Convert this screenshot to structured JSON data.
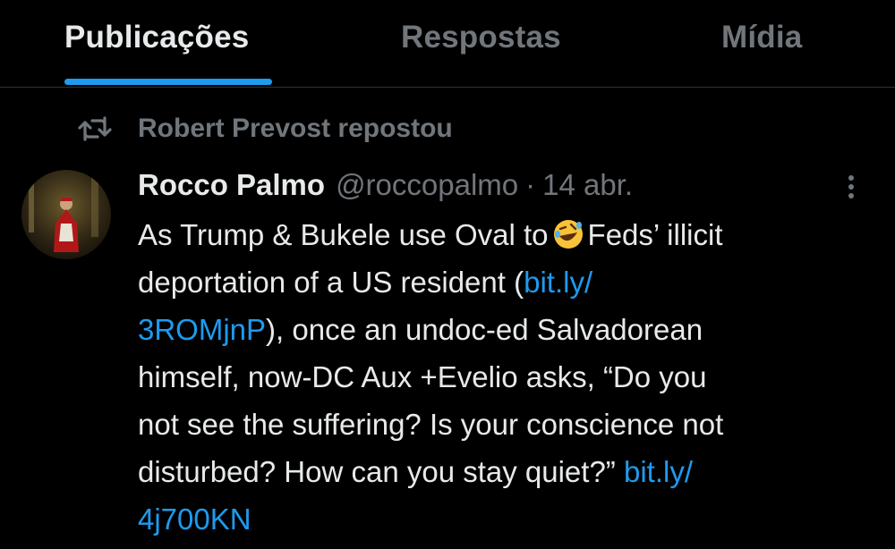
{
  "tabs": [
    {
      "label": "Publicações",
      "active": true
    },
    {
      "label": "Respostas",
      "active": false
    },
    {
      "label": "Mídia",
      "active": false
    }
  ],
  "repost": {
    "icon": "repost-icon",
    "text": "Robert Prevost repostou"
  },
  "tweet": {
    "author_name": "Rocco Palmo",
    "author_handle": "@roccopalmo",
    "separator": "·",
    "date": "14 abr.",
    "avatar_icon": "avatar-cardinal-photo",
    "body": {
      "l1_a": "As Trump & Bukele use Oval to",
      "emoji": "rolling-on-floor-laughing-emoji",
      "l1_b": "Feds’ illicit",
      "l2_a": "deportation of a US resident (",
      "l2_link": "bit.ly/",
      "l3_link": "3ROMjnP",
      "l3_b": "), once an undoc-ed Salvadorean",
      "l4": "himself, now-DC Aux +Evelio asks, “Do you",
      "l5": "not see the suffering? Is your conscience not",
      "l6_a": "disturbed? How can you stay quiet?” ",
      "l6_link": "bit.ly/",
      "l7_link": "4j700KN"
    }
  },
  "colors": {
    "background": "#000000",
    "primary_text": "#e7e9ea",
    "secondary_text": "#71767b",
    "accent": "#1d9bf0",
    "divider": "#2f3336"
  }
}
